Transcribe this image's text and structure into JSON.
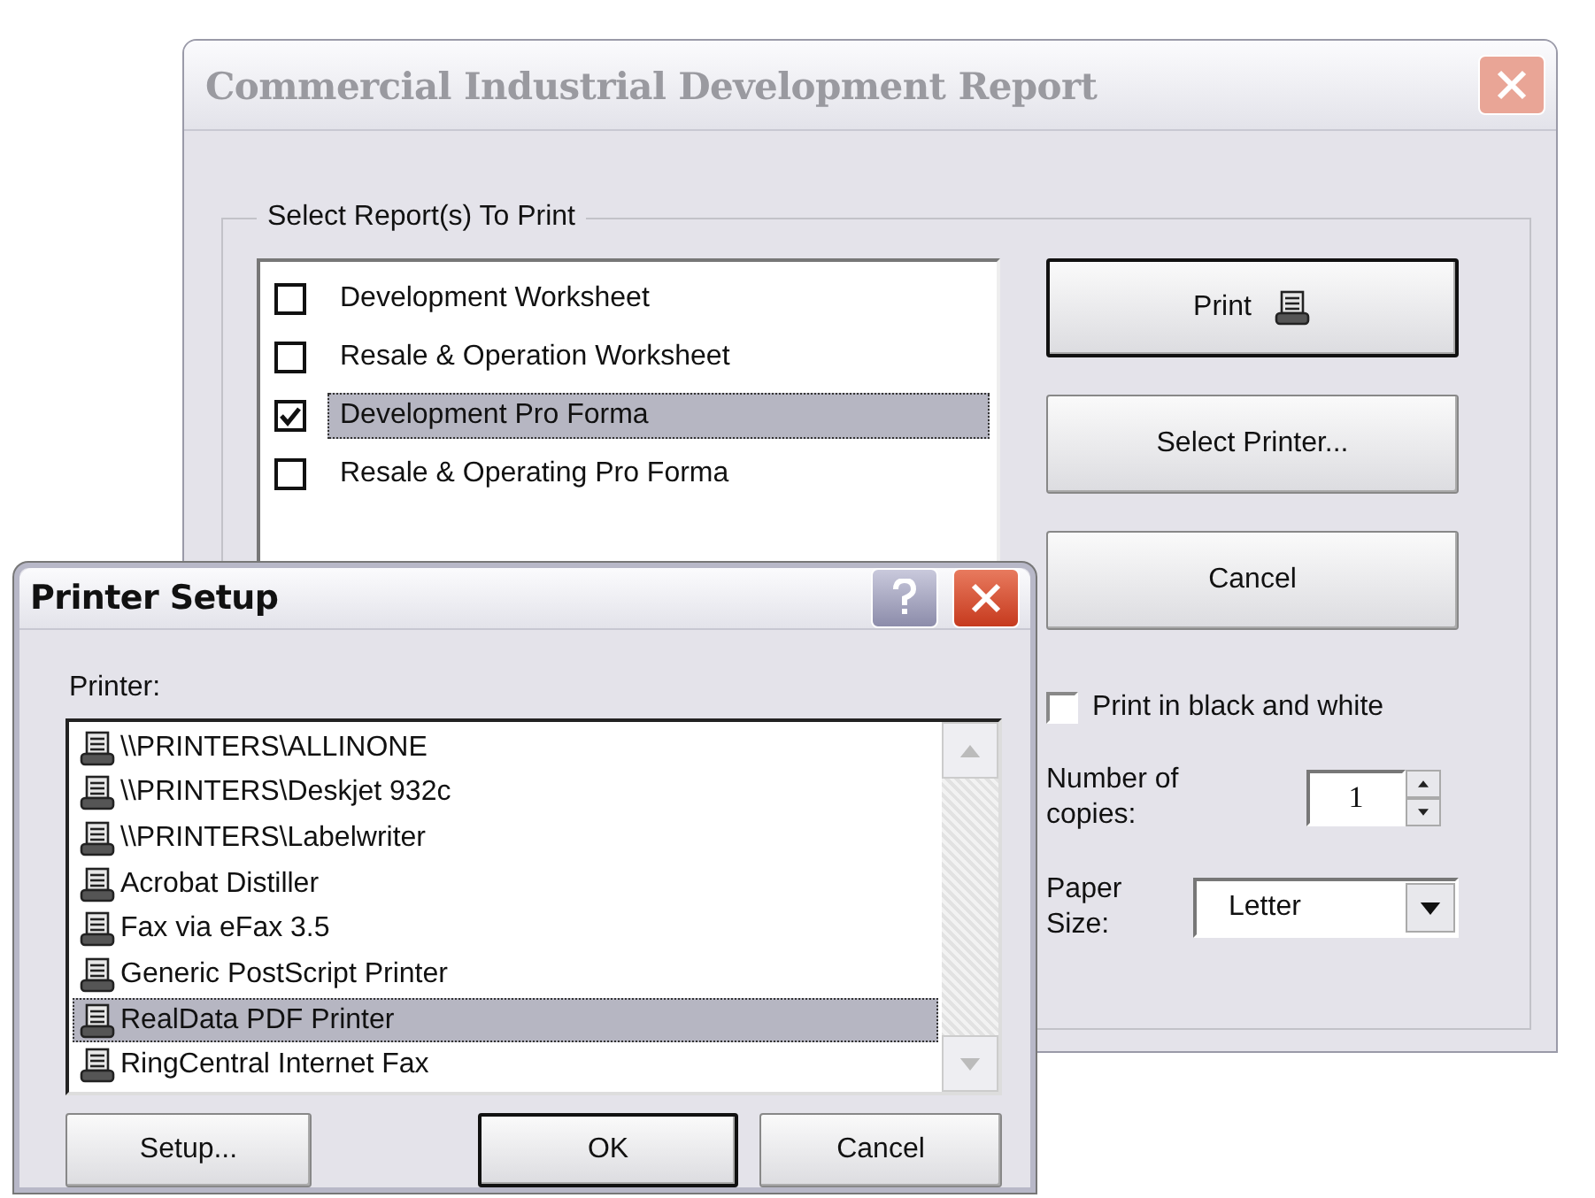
{
  "main_window": {
    "title": "Commercial Industrial Development Report",
    "active": false,
    "group": {
      "legend": "Select Report(s) To Print",
      "reports": [
        {
          "label": "Development Worksheet",
          "checked": false,
          "selected": false
        },
        {
          "label": "Resale & Operation Worksheet",
          "checked": false,
          "selected": false
        },
        {
          "label": "Development Pro Forma",
          "checked": true,
          "selected": true
        },
        {
          "label": "Resale & Operating Pro Forma",
          "checked": false,
          "selected": false
        }
      ],
      "actions": [
        {
          "label": "Print",
          "kind": "print",
          "default": true
        },
        {
          "label": "Select Printer...",
          "kind": "plain",
          "default": false
        },
        {
          "label": "Cancel",
          "kind": "plain",
          "default": false
        }
      ],
      "black_and_white": {
        "label": "Print in black and white",
        "checked": false
      },
      "copies": {
        "label": "Number of copies:",
        "value": "1"
      },
      "paper_size": {
        "label": "Paper Size:",
        "value": "Letter"
      }
    }
  },
  "printer_setup": {
    "title": "Printer Setup",
    "active": true,
    "list_label": "Printer:",
    "printers": [
      {
        "name": "\\\\PRINTERS\\ALLINONE",
        "selected": false
      },
      {
        "name": "\\\\PRINTERS\\Deskjet 932c",
        "selected": false
      },
      {
        "name": "\\\\PRINTERS\\Labelwriter",
        "selected": false
      },
      {
        "name": "Acrobat Distiller",
        "selected": false
      },
      {
        "name": "Fax via eFax 3.5",
        "selected": false
      },
      {
        "name": "Generic PostScript Printer",
        "selected": false
      },
      {
        "name": "RealData PDF Printer",
        "selected": true
      },
      {
        "name": "RingCentral Internet Fax",
        "selected": false
      }
    ],
    "buttons": [
      {
        "label": "Setup...",
        "default": false
      },
      {
        "label": "OK",
        "default": true
      },
      {
        "label": "Cancel",
        "default": false
      }
    ]
  }
}
